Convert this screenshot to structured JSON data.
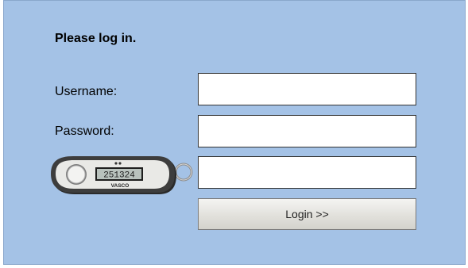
{
  "login": {
    "heading": "Please log in.",
    "username_label": "Username:",
    "password_label": "Password:",
    "username_value": "",
    "password_value": "",
    "otp_value": "",
    "login_button_label": "Login >>"
  },
  "token": {
    "display_code": "251324",
    "brand_text": "VASCO",
    "icon": "otp-token-icon"
  },
  "colors": {
    "panel_background": "#a4c2e6",
    "field_border": "#333333",
    "button_background": "#e2e1dc"
  }
}
